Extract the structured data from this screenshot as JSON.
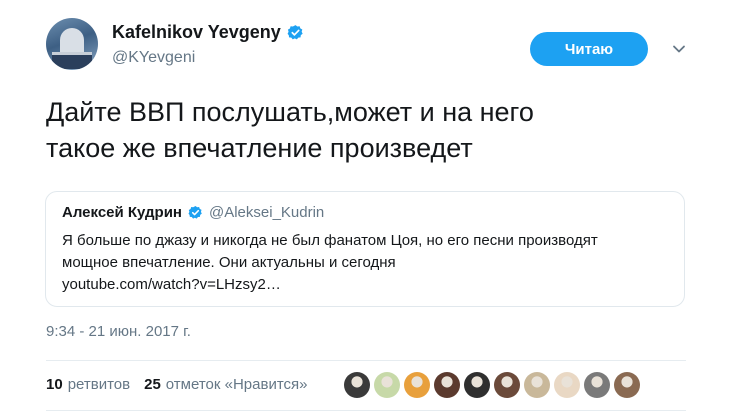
{
  "author": {
    "display_name": "Kafelnikov Yevgeny",
    "handle": "@KYevgeni",
    "verified": true,
    "avatar_icon": "user-avatar"
  },
  "follow_button": {
    "label": "Читаю"
  },
  "tweet": {
    "lines": [
      "Дайте ВВП послушать,может и на него",
      "такое же впечатление произведет"
    ]
  },
  "quoted_tweet": {
    "display_name": "Алексей Кудрин",
    "handle": "@Aleksei_Kudrin",
    "verified": true,
    "lines": [
      "Я больше по джазу и никогда не был фанатом Цоя, но его песни производят",
      "мощное впечатление. Они актуальны и сегодня",
      "youtube.com/watch?v=LHzsy2…"
    ]
  },
  "timestamp": "9:34 - 21 июн. 2017 г.",
  "stats": {
    "retweets_count": "10",
    "retweets_label": "ретвитов",
    "likes_count": "25",
    "likes_label": "отметок «Нравится»"
  },
  "colors": {
    "accent": "#1da1f2",
    "text": "#14171a",
    "secondary_text": "#657786",
    "border": "#e1e8ed"
  },
  "likers": [
    {
      "icon": "liker-avatar",
      "color": "#3a3a3a"
    },
    {
      "icon": "liker-avatar",
      "color": "#c7d9a8"
    },
    {
      "icon": "liker-avatar",
      "color": "#e8a03c"
    },
    {
      "icon": "liker-avatar",
      "color": "#5b3a2e"
    },
    {
      "icon": "liker-avatar",
      "color": "#2f2f2f"
    },
    {
      "icon": "liker-avatar",
      "color": "#6b4a3a"
    },
    {
      "icon": "liker-avatar",
      "color": "#c9b89a"
    },
    {
      "icon": "liker-avatar",
      "color": "#e9d8c4"
    },
    {
      "icon": "liker-avatar",
      "color": "#7a7a7a"
    },
    {
      "icon": "liker-avatar",
      "color": "#8a6a52"
    }
  ]
}
